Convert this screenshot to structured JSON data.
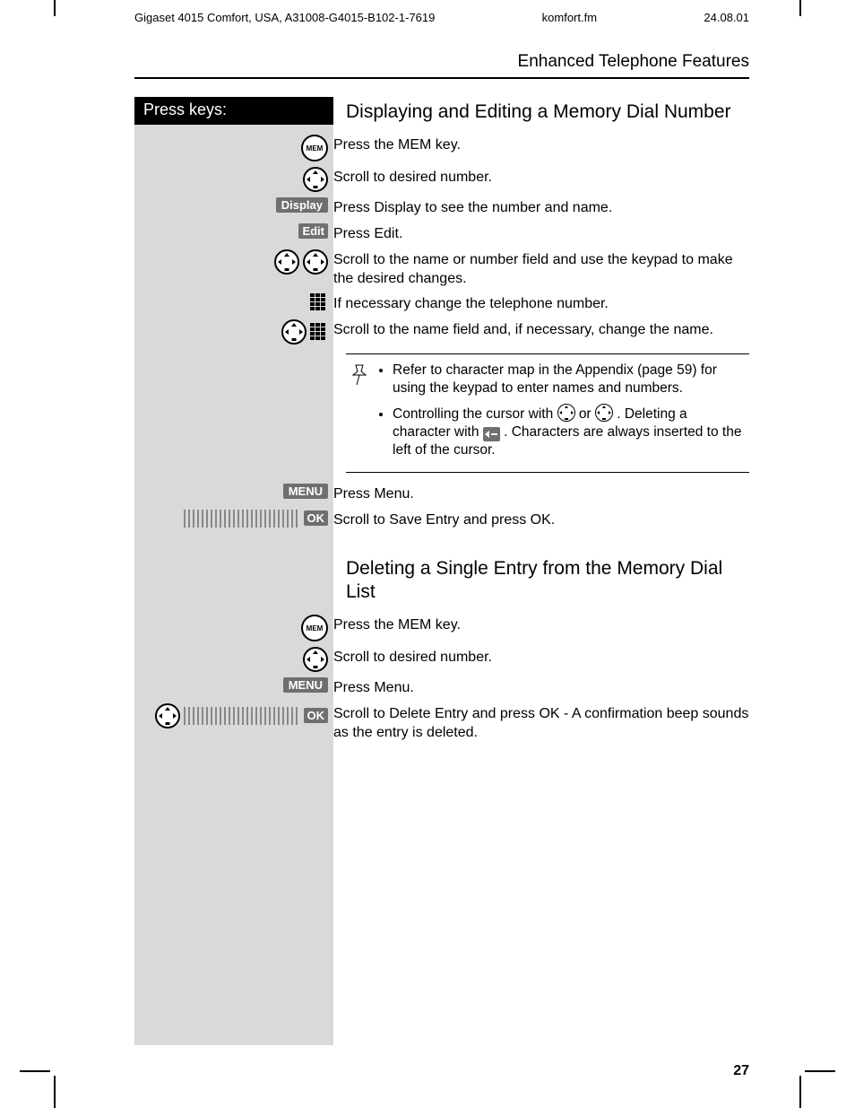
{
  "header": {
    "product": "Gigaset 4015 Comfort, USA, A31008-G4015-B102-1-7619",
    "file": "komfort.fm",
    "date": "24.08.01"
  },
  "section_title": "Enhanced Telephone Features",
  "left_col_header": "Press keys:",
  "sections": {
    "s1": {
      "heading": "Displaying and Editing a Memory Dial Number",
      "steps": {
        "mem": "Press the MEM key.",
        "scroll_num": "Scroll to desired number.",
        "display": "Press Display to see the number and name.",
        "edit": "Press Edit.",
        "scroll_field": "Scroll to the name or number field and use the keypad to make the desired changes.",
        "change_phone": "If necessary change the telephone number.",
        "change_name": "Scroll to the name field and, if necessary, change the name.",
        "press_menu": "Press Menu.",
        "save_entry": "Scroll to Save Entry and press OK."
      },
      "note": {
        "bullet1": "Refer to character map in the Appendix (page 59) for using the keypad to enter names and numbers.",
        "bullet2a": "Controlling the cursor with ",
        "bullet2b": " or ",
        "bullet2c": ". Deleting a character with ",
        "bullet2d": ". Characters are always inserted to the left of the cursor."
      }
    },
    "s2": {
      "heading": "Deleting a Single Entry from the Memory Dial List",
      "steps": {
        "mem": "Press the MEM key.",
        "scroll_num": "Scroll to desired number.",
        "press_menu": "Press Menu.",
        "delete_entry": "Scroll to Delete Entry and press OK - A confirmation beep sounds as the entry is deleted."
      }
    }
  },
  "key_labels": {
    "mem": "MEM",
    "display": "Display",
    "edit": "Edit",
    "menu": "MENU",
    "ok": "OK"
  },
  "page_number": "27"
}
